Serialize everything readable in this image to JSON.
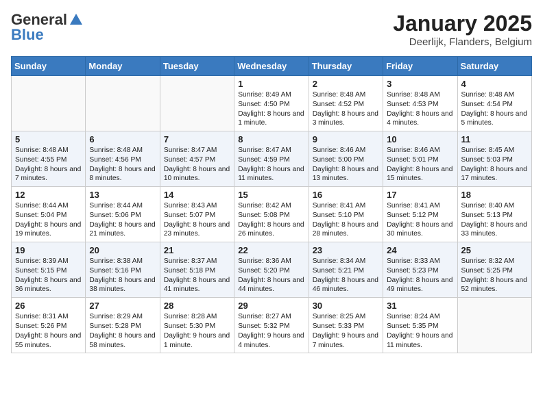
{
  "header": {
    "logo_general": "General",
    "logo_blue": "Blue",
    "month_title": "January 2025",
    "location": "Deerlijk, Flanders, Belgium"
  },
  "weekdays": [
    "Sunday",
    "Monday",
    "Tuesday",
    "Wednesday",
    "Thursday",
    "Friday",
    "Saturday"
  ],
  "weeks": [
    [
      {
        "day": "",
        "content": ""
      },
      {
        "day": "",
        "content": ""
      },
      {
        "day": "",
        "content": ""
      },
      {
        "day": "1",
        "content": "Sunrise: 8:49 AM\nSunset: 4:50 PM\nDaylight: 8 hours and 1 minute."
      },
      {
        "day": "2",
        "content": "Sunrise: 8:48 AM\nSunset: 4:52 PM\nDaylight: 8 hours and 3 minutes."
      },
      {
        "day": "3",
        "content": "Sunrise: 8:48 AM\nSunset: 4:53 PM\nDaylight: 8 hours and 4 minutes."
      },
      {
        "day": "4",
        "content": "Sunrise: 8:48 AM\nSunset: 4:54 PM\nDaylight: 8 hours and 5 minutes."
      }
    ],
    [
      {
        "day": "5",
        "content": "Sunrise: 8:48 AM\nSunset: 4:55 PM\nDaylight: 8 hours and 7 minutes."
      },
      {
        "day": "6",
        "content": "Sunrise: 8:48 AM\nSunset: 4:56 PM\nDaylight: 8 hours and 8 minutes."
      },
      {
        "day": "7",
        "content": "Sunrise: 8:47 AM\nSunset: 4:57 PM\nDaylight: 8 hours and 10 minutes."
      },
      {
        "day": "8",
        "content": "Sunrise: 8:47 AM\nSunset: 4:59 PM\nDaylight: 8 hours and 11 minutes."
      },
      {
        "day": "9",
        "content": "Sunrise: 8:46 AM\nSunset: 5:00 PM\nDaylight: 8 hours and 13 minutes."
      },
      {
        "day": "10",
        "content": "Sunrise: 8:46 AM\nSunset: 5:01 PM\nDaylight: 8 hours and 15 minutes."
      },
      {
        "day": "11",
        "content": "Sunrise: 8:45 AM\nSunset: 5:03 PM\nDaylight: 8 hours and 17 minutes."
      }
    ],
    [
      {
        "day": "12",
        "content": "Sunrise: 8:44 AM\nSunset: 5:04 PM\nDaylight: 8 hours and 19 minutes."
      },
      {
        "day": "13",
        "content": "Sunrise: 8:44 AM\nSunset: 5:06 PM\nDaylight: 8 hours and 21 minutes."
      },
      {
        "day": "14",
        "content": "Sunrise: 8:43 AM\nSunset: 5:07 PM\nDaylight: 8 hours and 23 minutes."
      },
      {
        "day": "15",
        "content": "Sunrise: 8:42 AM\nSunset: 5:08 PM\nDaylight: 8 hours and 26 minutes."
      },
      {
        "day": "16",
        "content": "Sunrise: 8:41 AM\nSunset: 5:10 PM\nDaylight: 8 hours and 28 minutes."
      },
      {
        "day": "17",
        "content": "Sunrise: 8:41 AM\nSunset: 5:12 PM\nDaylight: 8 hours and 30 minutes."
      },
      {
        "day": "18",
        "content": "Sunrise: 8:40 AM\nSunset: 5:13 PM\nDaylight: 8 hours and 33 minutes."
      }
    ],
    [
      {
        "day": "19",
        "content": "Sunrise: 8:39 AM\nSunset: 5:15 PM\nDaylight: 8 hours and 36 minutes."
      },
      {
        "day": "20",
        "content": "Sunrise: 8:38 AM\nSunset: 5:16 PM\nDaylight: 8 hours and 38 minutes."
      },
      {
        "day": "21",
        "content": "Sunrise: 8:37 AM\nSunset: 5:18 PM\nDaylight: 8 hours and 41 minutes."
      },
      {
        "day": "22",
        "content": "Sunrise: 8:36 AM\nSunset: 5:20 PM\nDaylight: 8 hours and 44 minutes."
      },
      {
        "day": "23",
        "content": "Sunrise: 8:34 AM\nSunset: 5:21 PM\nDaylight: 8 hours and 46 minutes."
      },
      {
        "day": "24",
        "content": "Sunrise: 8:33 AM\nSunset: 5:23 PM\nDaylight: 8 hours and 49 minutes."
      },
      {
        "day": "25",
        "content": "Sunrise: 8:32 AM\nSunset: 5:25 PM\nDaylight: 8 hours and 52 minutes."
      }
    ],
    [
      {
        "day": "26",
        "content": "Sunrise: 8:31 AM\nSunset: 5:26 PM\nDaylight: 8 hours and 55 minutes."
      },
      {
        "day": "27",
        "content": "Sunrise: 8:29 AM\nSunset: 5:28 PM\nDaylight: 8 hours and 58 minutes."
      },
      {
        "day": "28",
        "content": "Sunrise: 8:28 AM\nSunset: 5:30 PM\nDaylight: 9 hours and 1 minute."
      },
      {
        "day": "29",
        "content": "Sunrise: 8:27 AM\nSunset: 5:32 PM\nDaylight: 9 hours and 4 minutes."
      },
      {
        "day": "30",
        "content": "Sunrise: 8:25 AM\nSunset: 5:33 PM\nDaylight: 9 hours and 7 minutes."
      },
      {
        "day": "31",
        "content": "Sunrise: 8:24 AM\nSunset: 5:35 PM\nDaylight: 9 hours and 11 minutes."
      },
      {
        "day": "",
        "content": ""
      }
    ]
  ]
}
